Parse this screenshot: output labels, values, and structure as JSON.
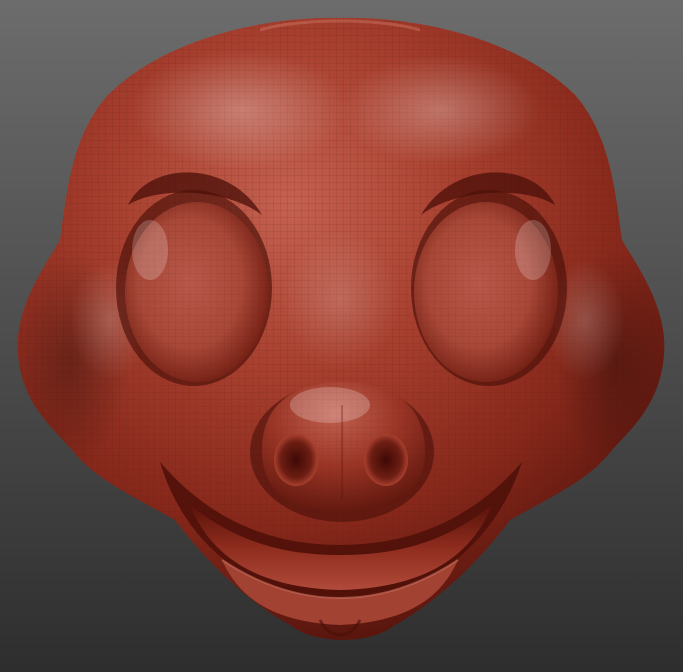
{
  "viewport": {
    "background_top": "#6c6c6c",
    "background_bottom": "#2e2e2e",
    "clay_light": "#c25a48",
    "clay_mid": "#9c3424",
    "clay_dark": "#5a140c",
    "wireframe": "#5e1a10"
  },
  "model": {
    "subject": "sculpted-cartoon-pig-head",
    "material": "red-clay-matcap",
    "polyframe": true
  }
}
